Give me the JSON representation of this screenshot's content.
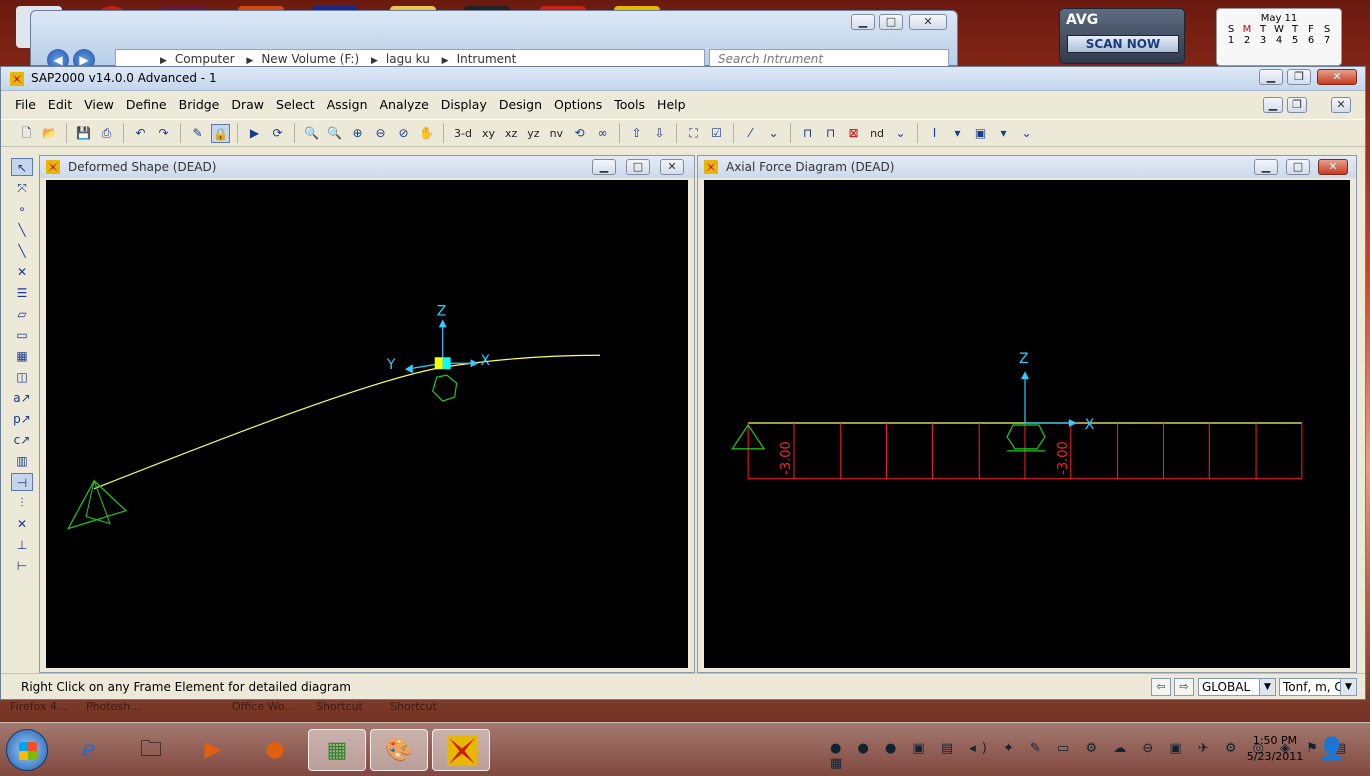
{
  "explorer": {
    "address_parts": [
      "Computer",
      "New Volume (F:)",
      "lagu ku",
      "Intrument"
    ],
    "search_placeholder": "Search Intrument"
  },
  "avg": {
    "logo": "AVG",
    "scan_label": "SCAN NOW"
  },
  "calendar": {
    "month": "May 11",
    "weekdays": [
      "S",
      "M",
      "T",
      "W",
      "T",
      "F",
      "S"
    ],
    "week1": [
      "1",
      "2",
      "3",
      "4",
      "5",
      "6",
      "7"
    ]
  },
  "app": {
    "title": "SAP2000 v14.0.0 Advanced  - 1",
    "menu": [
      "File",
      "Edit",
      "View",
      "Define",
      "Bridge",
      "Draw",
      "Select",
      "Assign",
      "Analyze",
      "Display",
      "Design",
      "Options",
      "Tools",
      "Help"
    ],
    "toolbar_text": {
      "view3d": "3-d",
      "xy": "xy",
      "xz": "xz",
      "yz": "yz",
      "nv": "nv",
      "nd": "nd"
    }
  },
  "views": {
    "left": {
      "title": "Deformed Shape (DEAD)",
      "axis_z": "Z",
      "axis_x": "X",
      "axis_y": "Y"
    },
    "right": {
      "title": "Axial Force Diagram   (DEAD)",
      "axis_z": "Z",
      "axis_x": "X",
      "value_left": "-3.00",
      "value_mid": "-3.00"
    }
  },
  "status": {
    "message": "Right Click on any Frame Element for detailed diagram",
    "coord_system": "GLOBAL",
    "units": "Tonf, m, C"
  },
  "desktop_labels": [
    "Firefox 4...",
    "Photosh...",
    "Office Wo...",
    "Shortcut",
    "Shortcut"
  ],
  "clock": {
    "time": "1:50 PM",
    "date": "5/23/2011"
  },
  "colors": {
    "deformed": "#ffff66",
    "support": "#22cc22",
    "axis": "#33ccff",
    "force": "#ff2222"
  }
}
